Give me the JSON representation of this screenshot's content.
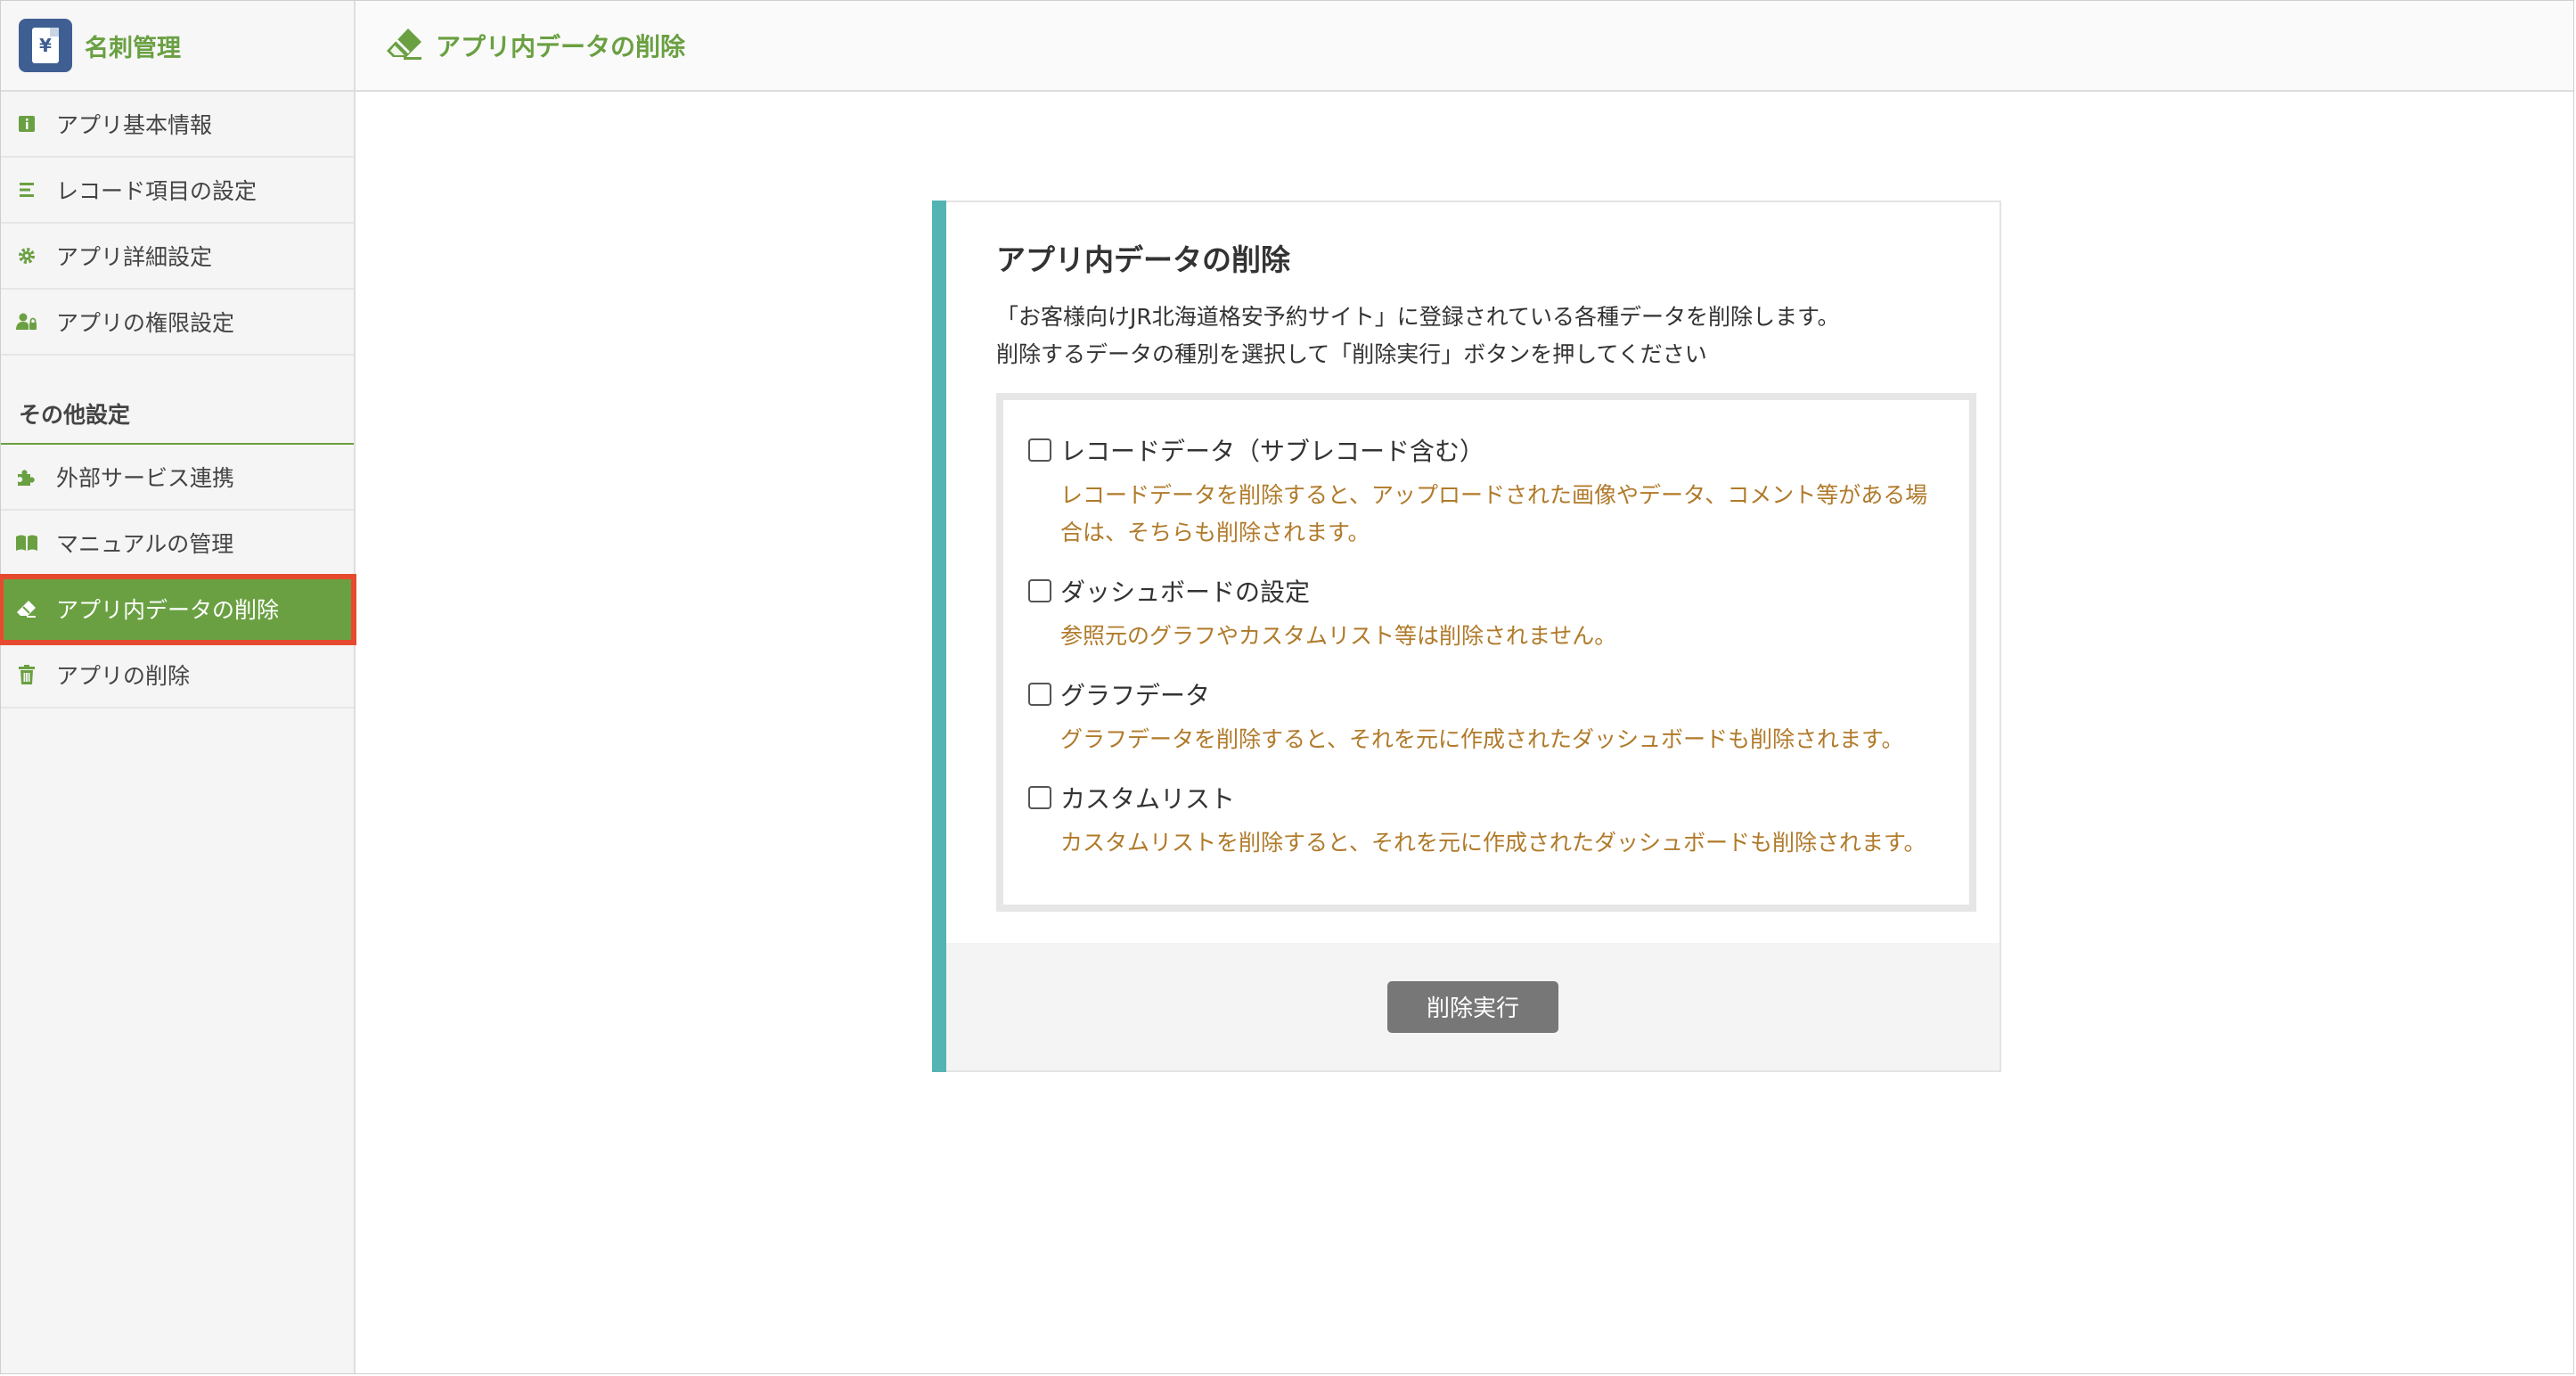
{
  "app": {
    "name": "名刺管理",
    "logo_glyph": "¥"
  },
  "header": {
    "title": "アプリ内データの削除"
  },
  "sidebar": {
    "items": [
      {
        "label": "アプリ基本情報",
        "icon": "info-icon"
      },
      {
        "label": "レコード項目の設定",
        "icon": "list-icon"
      },
      {
        "label": "アプリ詳細設定",
        "icon": "gear-icon"
      },
      {
        "label": "アプリの権限設定",
        "icon": "user-lock-icon"
      }
    ],
    "section_title": "その他設定",
    "other_items": [
      {
        "label": "外部サービス連携",
        "icon": "puzzle-icon"
      },
      {
        "label": "マニュアルの管理",
        "icon": "book-icon"
      },
      {
        "label": "アプリ内データの削除",
        "icon": "eraser-icon",
        "active": true
      },
      {
        "label": "アプリの削除",
        "icon": "trash-icon"
      }
    ]
  },
  "main": {
    "card_title": "アプリ内データの削除",
    "desc_line1": "「お客様向けJR北海道格安予約サイト」に登録されている各種データを削除します。",
    "desc_line2": "削除するデータの種別を選択して「削除実行」ボタンを押してください",
    "options": [
      {
        "label": "レコードデータ（サブレコード含む）",
        "note": "レコードデータを削除すると、アップロードされた画像やデータ、コメント等がある場合は、そちらも削除されます。",
        "checked": false
      },
      {
        "label": "ダッシュボードの設定",
        "note": "参照元のグラフやカスタムリスト等は削除されません。",
        "checked": false
      },
      {
        "label": "グラフデータ",
        "note": "グラフデータを削除すると、それを元に作成されたダッシュボードも削除されます。",
        "checked": false
      },
      {
        "label": "カスタムリスト",
        "note": "カスタムリストを削除すると、それを元に作成されたダッシュボードも削除されます。",
        "checked": false
      }
    ],
    "execute_label": "削除実行"
  },
  "colors": {
    "accent_green": "#6aa042",
    "accent_teal": "#54b4b4",
    "note_orange": "#b07a2a",
    "highlight_red": "#e64a2e",
    "button_gray": "#777777"
  }
}
